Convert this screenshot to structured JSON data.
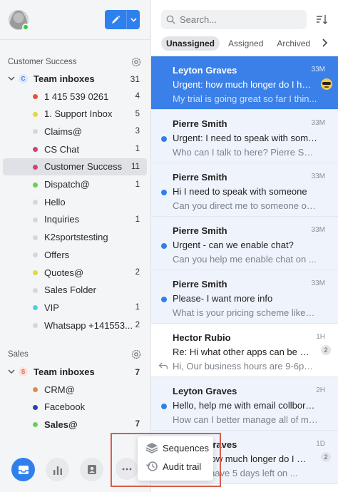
{
  "compose": {
    "icon": "pencil-icon",
    "dropdown_icon": "chevron-down-icon",
    "accent": "#2f80ed"
  },
  "sidebar": {
    "sections": [
      {
        "title": "Customer Success",
        "group": {
          "initial": "C",
          "label": "Team inboxes",
          "count": "31"
        },
        "inboxes": [
          {
            "name": "1 415 539 0261",
            "count": "4",
            "color": "#e0533d"
          },
          {
            "name": "1. Support Inbox",
            "count": "5",
            "color": "#e5d83a"
          },
          {
            "name": "Claims@",
            "count": "3",
            "color": "#d5d7db"
          },
          {
            "name": "CS Chat",
            "count": "1",
            "color": "#d1427a"
          },
          {
            "name": "Customer Success",
            "count": "11",
            "color": "#d1427a"
          },
          {
            "name": "Dispatch@",
            "count": "1",
            "color": "#6ccf55"
          },
          {
            "name": "Hello",
            "count": "",
            "color": "#d5d7db"
          },
          {
            "name": "Inquiries",
            "count": "1",
            "color": "#d5d7db"
          },
          {
            "name": "K2sportstesting",
            "count": "",
            "color": "#d5d7db"
          },
          {
            "name": "Offers",
            "count": "",
            "color": "#d5d7db"
          },
          {
            "name": "Quotes@",
            "count": "2",
            "color": "#e5d83a"
          },
          {
            "name": "Sales Folder",
            "count": "",
            "color": "#d5d7db"
          },
          {
            "name": "VIP",
            "count": "1",
            "color": "#4fd0e0"
          },
          {
            "name": "Whatsapp +141553...",
            "count": "2",
            "color": "#d5d7db"
          }
        ]
      },
      {
        "title": "Sales",
        "group": {
          "initial": "S",
          "label": "Team inboxes",
          "count": "7"
        },
        "inboxes": [
          {
            "name": "CRM@",
            "count": "",
            "color": "#e08a4f"
          },
          {
            "name": "Facebook",
            "count": "",
            "color": "#2b3fb5"
          },
          {
            "name": "Sales@",
            "count": "7",
            "color": "#6ccf55"
          }
        ]
      }
    ]
  },
  "main": {
    "search_placeholder": "Search...",
    "tabs": [
      "Unassigned",
      "Assigned",
      "Archived"
    ],
    "conversations": [
      {
        "from": "Leyton Graves",
        "time": "33M",
        "subject": "Urgent: how much longer do I hav...",
        "preview": "My trial is going great so far I thin...",
        "badge": ""
      },
      {
        "from": "Pierre Smith",
        "time": "33M",
        "subject": "Urgent: I need to speak with someon...",
        "preview": "Who can I talk to here? Pierre Smith",
        "badge": ""
      },
      {
        "from": "Pierre Smith",
        "time": "33M",
        "subject": "Hi I need to speak with someone",
        "preview": "Can you direct me to someone on ...",
        "badge": ""
      },
      {
        "from": "Pierre Smith",
        "time": "33M",
        "subject": "Urgent - can we enable chat?",
        "preview": "Can you help me enable chat on ...",
        "badge": ""
      },
      {
        "from": "Pierre Smith",
        "time": "33M",
        "subject": "Please- I want more info",
        "preview": "What is your pricing scheme like? ...",
        "badge": ""
      },
      {
        "from": "Hector Rubio",
        "time": "1H",
        "subject": "Re: Hi what other apps can be inte...",
        "preview": "Hi, Our business hours are 9-6pm...",
        "badge": "2"
      },
      {
        "from": "Leyton Graves",
        "time": "2H",
        "subject": "Hello, help me with email collboration",
        "preview": "How can I better manage all of my...",
        "badge": ""
      },
      {
        "from": "Leyton Graves",
        "time": "1D",
        "subject": "Urgent: how much longer do I hav...",
        "preview": "Can you have 5 days left on ...",
        "badge": "2"
      }
    ]
  },
  "popup": {
    "items": [
      {
        "label": "Sequences",
        "icon": "layers-icon"
      },
      {
        "label": "Audit trail",
        "icon": "history-icon"
      }
    ]
  }
}
